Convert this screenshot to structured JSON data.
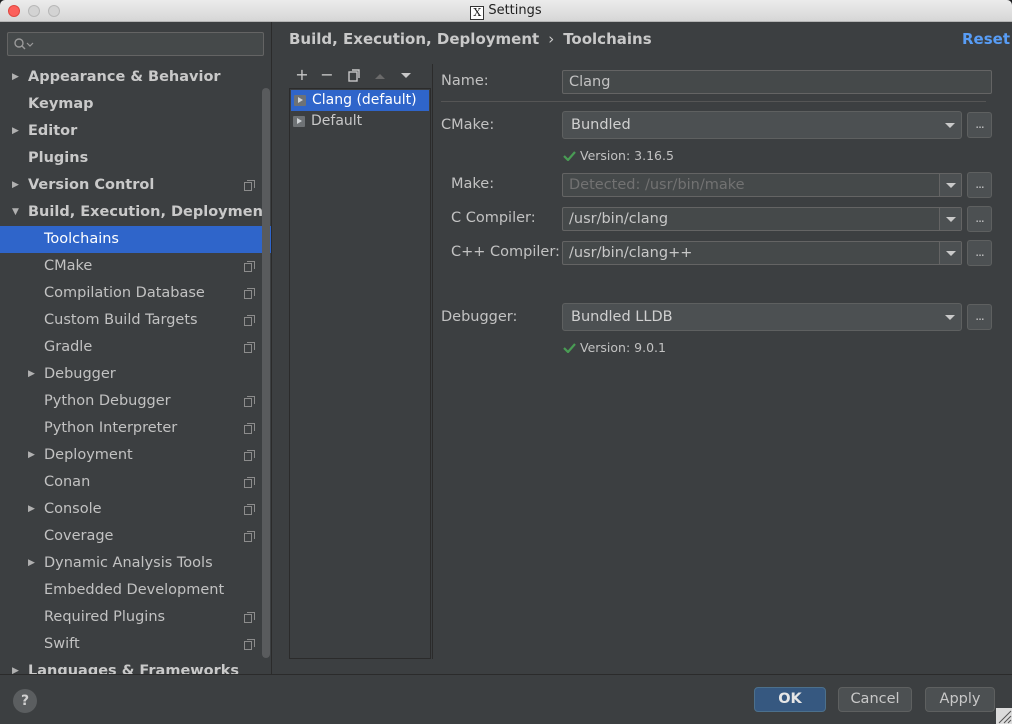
{
  "window": {
    "title": "Settings"
  },
  "search": {
    "placeholder": ""
  },
  "sidebar": {
    "items": [
      {
        "label": "Appearance & Behavior",
        "level": 0,
        "arrow": "right",
        "copy": false,
        "selected": false
      },
      {
        "label": "Keymap",
        "level": 0,
        "arrow": "",
        "copy": false,
        "selected": false
      },
      {
        "label": "Editor",
        "level": 0,
        "arrow": "right",
        "copy": false,
        "selected": false
      },
      {
        "label": "Plugins",
        "level": 0,
        "arrow": "",
        "copy": false,
        "selected": false
      },
      {
        "label": "Version Control",
        "level": 0,
        "arrow": "right",
        "copy": true,
        "selected": false
      },
      {
        "label": "Build, Execution, Deployment",
        "level": 0,
        "arrow": "down",
        "copy": false,
        "selected": false
      },
      {
        "label": "Toolchains",
        "level": 1,
        "arrow": "",
        "copy": false,
        "selected": true
      },
      {
        "label": "CMake",
        "level": 1,
        "arrow": "",
        "copy": true,
        "selected": false
      },
      {
        "label": "Compilation Database",
        "level": 1,
        "arrow": "",
        "copy": true,
        "selected": false
      },
      {
        "label": "Custom Build Targets",
        "level": 1,
        "arrow": "",
        "copy": true,
        "selected": false
      },
      {
        "label": "Gradle",
        "level": 1,
        "arrow": "",
        "copy": true,
        "selected": false
      },
      {
        "label": "Debugger",
        "level": 1,
        "arrow": "right",
        "copy": false,
        "selected": false
      },
      {
        "label": "Python Debugger",
        "level": 1,
        "arrow": "",
        "copy": true,
        "selected": false
      },
      {
        "label": "Python Interpreter",
        "level": 1,
        "arrow": "",
        "copy": true,
        "selected": false
      },
      {
        "label": "Deployment",
        "level": 1,
        "arrow": "right",
        "copy": true,
        "selected": false
      },
      {
        "label": "Conan",
        "level": 1,
        "arrow": "",
        "copy": true,
        "selected": false
      },
      {
        "label": "Console",
        "level": 1,
        "arrow": "right",
        "copy": true,
        "selected": false
      },
      {
        "label": "Coverage",
        "level": 1,
        "arrow": "",
        "copy": true,
        "selected": false
      },
      {
        "label": "Dynamic Analysis Tools",
        "level": 1,
        "arrow": "right",
        "copy": false,
        "selected": false
      },
      {
        "label": "Embedded Development",
        "level": 1,
        "arrow": "",
        "copy": false,
        "selected": false
      },
      {
        "label": "Required Plugins",
        "level": 1,
        "arrow": "",
        "copy": true,
        "selected": false
      },
      {
        "label": "Swift",
        "level": 1,
        "arrow": "",
        "copy": true,
        "selected": false
      },
      {
        "label": "Languages & Frameworks",
        "level": 0,
        "arrow": "right",
        "copy": false,
        "selected": false
      }
    ]
  },
  "breadcrumb": {
    "parent": "Build, Execution, Deployment",
    "separator": "›",
    "current": "Toolchains"
  },
  "header": {
    "reset_label": "Reset"
  },
  "toolchains": {
    "toolbar": {
      "add": "+",
      "remove": "−"
    },
    "items": [
      {
        "label": "Clang (default)",
        "selected": true
      },
      {
        "label": "Default",
        "selected": false
      }
    ]
  },
  "form": {
    "name_label": "Name:",
    "name_value": "Clang",
    "cmake_label": "CMake:",
    "cmake_value": "Bundled",
    "cmake_version": "Version: 3.16.5",
    "make_label": "Make:",
    "make_value": "Detected: /usr/bin/make",
    "c_compiler_label": "C Compiler:",
    "c_compiler_value": "/usr/bin/clang",
    "cpp_compiler_label": "C++ Compiler:",
    "cpp_compiler_value": "/usr/bin/clang++",
    "debugger_label": "Debugger:",
    "debugger_value": "Bundled LLDB",
    "debugger_version": "Version: 9.0.1",
    "browse_label": "..."
  },
  "footer": {
    "help": "?",
    "ok": "OK",
    "cancel": "Cancel",
    "apply": "Apply"
  },
  "colors": {
    "accent": "#2f65ca",
    "link": "#589df6",
    "check": "#499c54",
    "primary_button": "#365880"
  }
}
